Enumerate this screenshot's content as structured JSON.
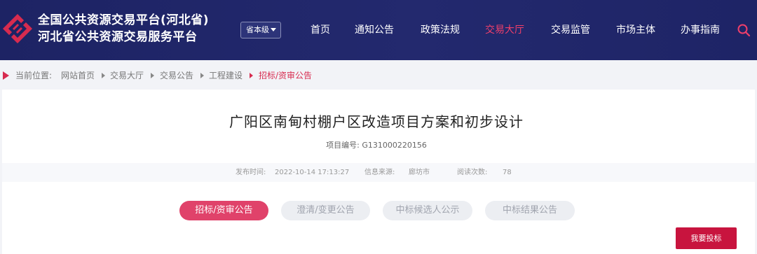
{
  "header": {
    "brand_line1": "全国公共资源交易平台(河北省)",
    "brand_line2": "河北省公共资源交易服务平台",
    "level_select": "省本级",
    "nav": [
      {
        "label": "首页",
        "active": false
      },
      {
        "label": "通知公告",
        "active": false
      },
      {
        "label": "政策法规",
        "active": false
      },
      {
        "label": "交易大厅",
        "active": true
      },
      {
        "label": "交易监管",
        "active": false
      },
      {
        "label": "市场主体",
        "active": false
      },
      {
        "label": "办事指南",
        "active": false
      }
    ],
    "accent_color": "#ef3f6a",
    "background_color": "#1d2364"
  },
  "breadcrumb": {
    "prefix": "当前位置:",
    "items": [
      "网站首页",
      "交易大厅",
      "交易公告",
      "工程建设",
      "招标/资审公告"
    ]
  },
  "article": {
    "title": "广阳区南甸村棚户区改造项目方案和初步设计",
    "project_no_label": "项目编号:",
    "project_no": "G131000220156",
    "publish_label": "发布时间:",
    "publish_time": "2022-10-14 17:13:27",
    "source_label": "信息来源:",
    "source": "廊坊市",
    "views_label": "阅读次数:",
    "views": "78"
  },
  "tabs": [
    {
      "label": "招标/资审公告",
      "active": true
    },
    {
      "label": "澄清/变更公告",
      "active": false
    },
    {
      "label": "中标候选人公示",
      "active": false
    },
    {
      "label": "中标结果公告",
      "active": false
    }
  ],
  "actions": {
    "bid_button": "我要投标",
    "bid_color": "#c8143e"
  }
}
